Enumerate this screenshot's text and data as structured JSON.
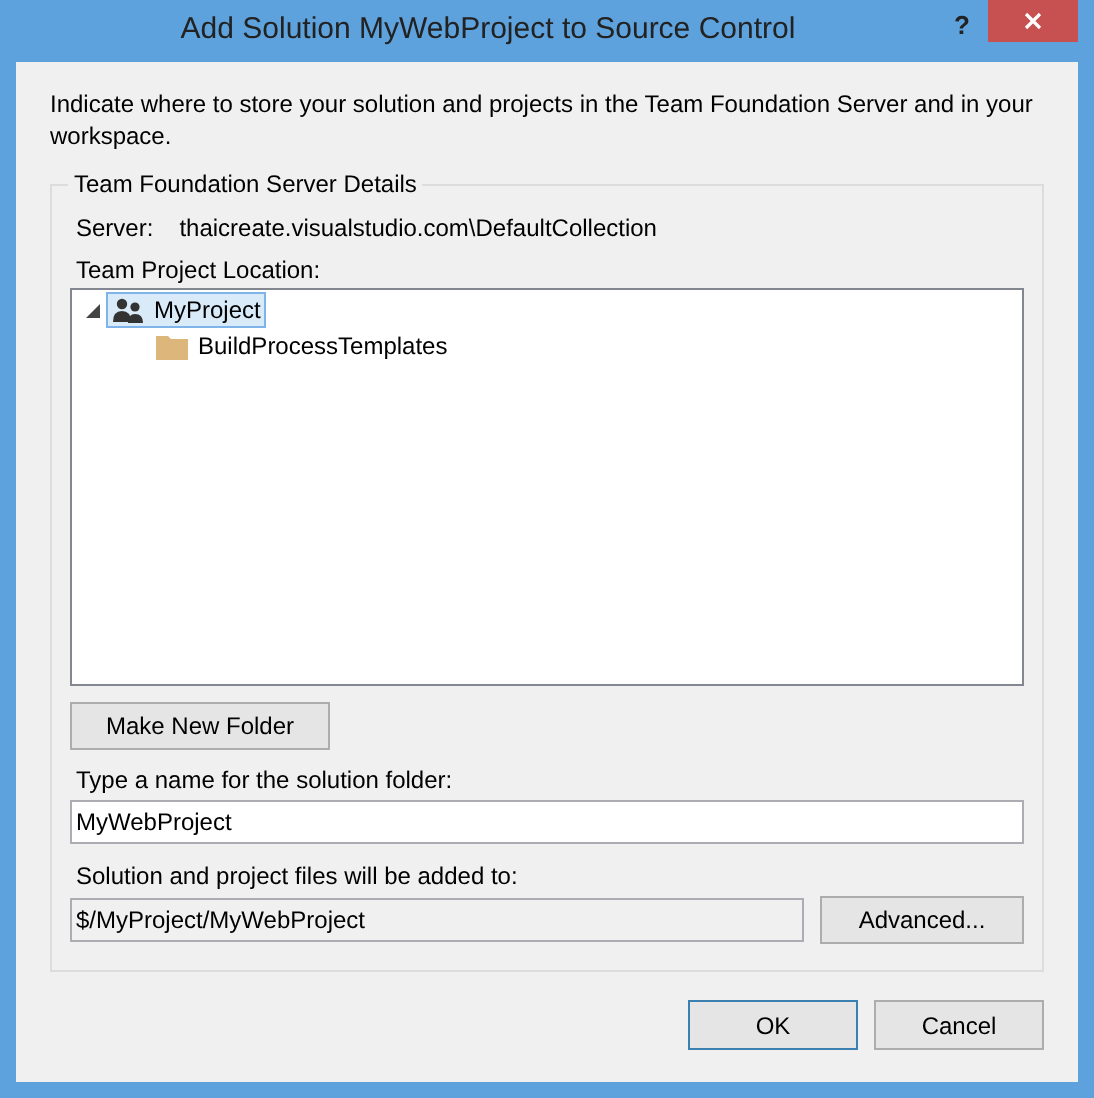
{
  "window": {
    "title": "Add Solution MyWebProject to Source Control",
    "help": "?"
  },
  "intro": "Indicate where to store your solution and projects in the Team Foundation Server and in your workspace.",
  "group": {
    "title": "Team Foundation Server Details",
    "server_label": "Server:",
    "server_value": "thaicreate.visualstudio.com\\DefaultCollection",
    "location_label": "Team Project Location:",
    "tree": [
      {
        "label": "MyProject",
        "kind": "team-project",
        "selected": true,
        "expanded": true,
        "children": [
          {
            "label": "BuildProcessTemplates",
            "kind": "folder",
            "selected": false,
            "expanded": false
          }
        ]
      }
    ],
    "new_folder_button": "Make New Folder",
    "folder_name_label": "Type a name for the solution folder:",
    "folder_name_value": "MyWebProject",
    "path_label": "Solution and project files will be added to:",
    "path_value": "$/MyProject/MyWebProject",
    "advanced_button": "Advanced..."
  },
  "buttons": [
    {
      "label": "OK",
      "default": true
    },
    {
      "label": "Cancel",
      "default": false
    }
  ]
}
